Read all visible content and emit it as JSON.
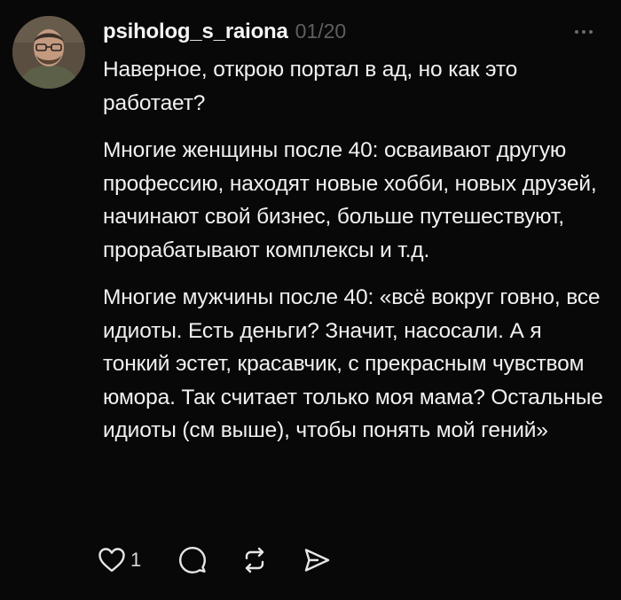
{
  "post": {
    "username": "psiholog_s_raiona",
    "counter": "01/20",
    "paragraphs": [
      "Наверное, открою портал в ад, но как это работает?",
      "Многие женщины после 40: осваивают другую профессию, находят новые хобби, новых друзей, начинают свой бизнес, больше путешествуют, прорабатывают комплексы и т.д.",
      "Многие мужчины после 40: «всё вокруг говно, все идиоты. Есть деньги? Значит, насосали. А я тонкий эстет, красавчик, с прекрасным чувством юмора. Так считает только моя мама? Остальные идиоты (см выше), чтобы понять мой гений»"
    ],
    "actions": {
      "like_count": "1",
      "like_icon": "heart-icon",
      "reply_icon": "comment-icon",
      "repost_icon": "repost-icon",
      "share_icon": "send-icon"
    }
  },
  "colors": {
    "background": "#080808",
    "text": "#f1f1f1",
    "muted": "#5f5f5f"
  }
}
